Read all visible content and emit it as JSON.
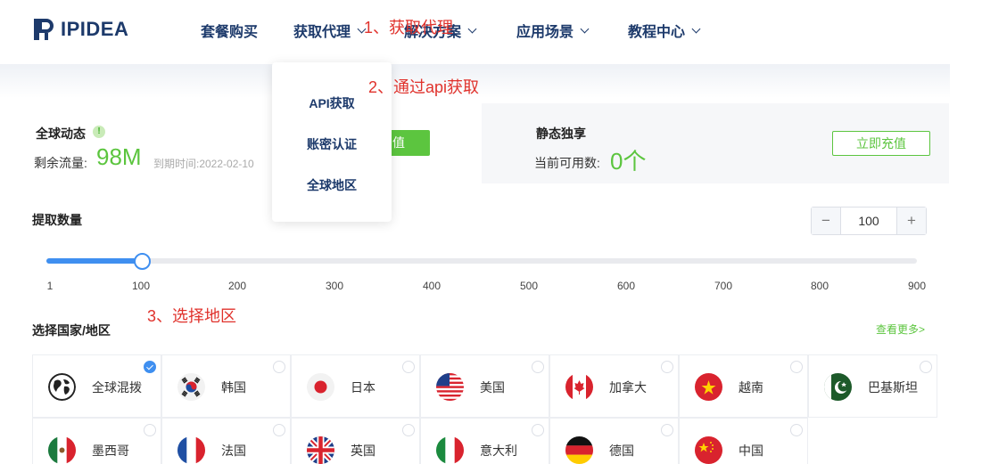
{
  "header": {
    "logo_text": "IPIDEA",
    "nav": [
      {
        "label": "套餐购买",
        "has_dropdown": false
      },
      {
        "label": "获取代理",
        "has_dropdown": true
      },
      {
        "label": "解决方案",
        "has_dropdown": true
      },
      {
        "label": "应用场景",
        "has_dropdown": true
      },
      {
        "label": "教程中心",
        "has_dropdown": true
      }
    ]
  },
  "annotations": [
    "1、获取代理",
    "2、通过api获取",
    "3、选择地区"
  ],
  "annotation_color": "#e0322c",
  "dropdown": {
    "items": [
      "API获取",
      "账密认证",
      "全球地区"
    ]
  },
  "balance": {
    "global": {
      "title": "全球动态",
      "remaining_label": "剩余流量:",
      "remaining_value": "98M",
      "expire": "到期时间:2022-02-10",
      "button_label": "值"
    },
    "static": {
      "title": "静态独享",
      "available_label": "当前可用数:",
      "available_value": "0个",
      "button_label": "立即充值"
    }
  },
  "quantity": {
    "title": "提取数量",
    "value": "100",
    "minus": "−",
    "plus": "+",
    "slider": {
      "min": 1,
      "max": 900,
      "value": 100
    },
    "ticks": [
      "1",
      "100",
      "200",
      "300",
      "400",
      "500",
      "600",
      "700",
      "800",
      "900"
    ]
  },
  "regions": {
    "title": "选择国家/地区",
    "more": "查看更多>",
    "items": [
      {
        "label": "全球混拨",
        "flag": "globe-icon",
        "selected": true
      },
      {
        "label": "韩国",
        "flag": "korea-flag-icon",
        "selected": false
      },
      {
        "label": "日本",
        "flag": "japan-flag-icon",
        "selected": false
      },
      {
        "label": "美国",
        "flag": "usa-flag-icon",
        "selected": false
      },
      {
        "label": "加拿大",
        "flag": "canada-flag-icon",
        "selected": false
      },
      {
        "label": "越南",
        "flag": "vietnam-flag-icon",
        "selected": false
      },
      {
        "label": "巴基斯坦",
        "flag": "pakistan-flag-icon",
        "selected": false
      },
      {
        "label": "墨西哥",
        "flag": "mexico-flag-icon",
        "selected": false
      },
      {
        "label": "法国",
        "flag": "france-flag-icon",
        "selected": false
      },
      {
        "label": "英国",
        "flag": "uk-flag-icon",
        "selected": false
      },
      {
        "label": "意大利",
        "flag": "italy-flag-icon",
        "selected": false
      },
      {
        "label": "德国",
        "flag": "germany-flag-icon",
        "selected": false
      },
      {
        "label": "中国",
        "flag": "china-flag-icon",
        "selected": false
      }
    ]
  },
  "colors": {
    "brand": "#1d3a6b",
    "accent_green": "#5cc53f",
    "accent_blue": "#3f8ff0"
  }
}
